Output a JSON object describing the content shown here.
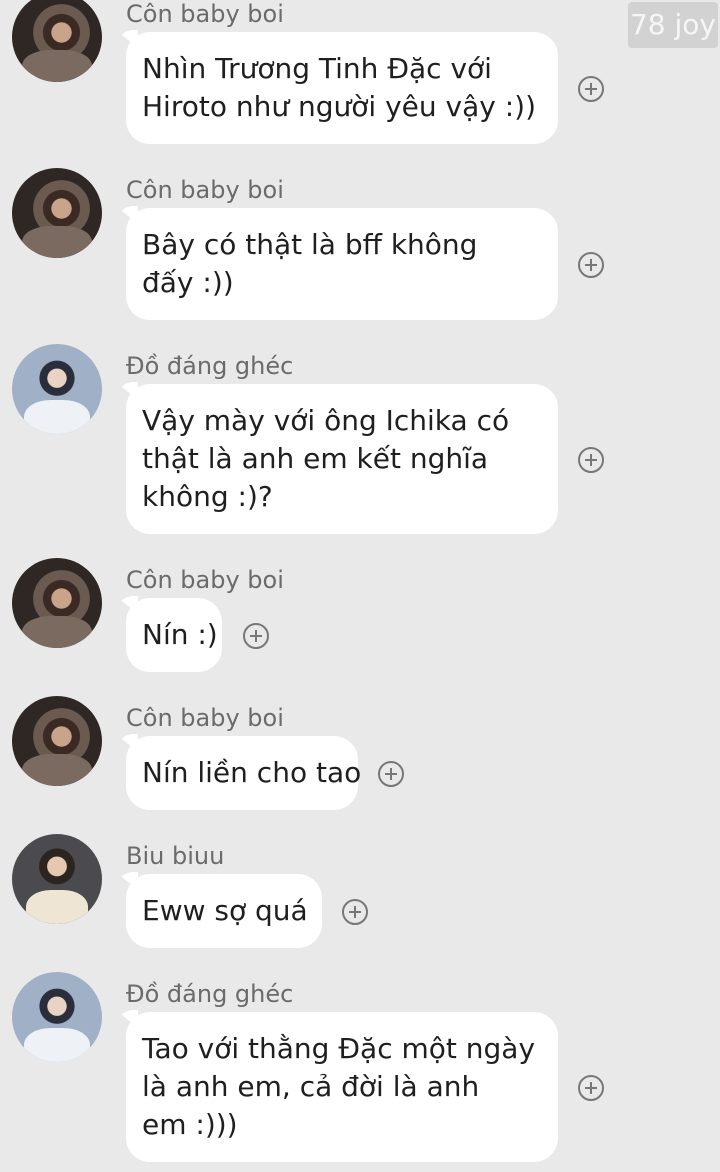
{
  "watermark": "78 joy",
  "messages": [
    {
      "sender": "Côn baby boi",
      "lines": [
        "Nhìn Trương Tinh Đặc với",
        "Hiroto như người yêu vậy :))"
      ]
    },
    {
      "sender": "Côn baby boi",
      "lines": [
        "Bây có thật là bff không",
        "đấy :))"
      ]
    },
    {
      "sender": "Đồ đáng ghéc",
      "lines": [
        "Vậy mày với ông Ichika có",
        "thật là anh em kết nghĩa",
        "không :)?"
      ]
    },
    {
      "sender": "Côn baby boi",
      "lines": [
        "Nín :)"
      ]
    },
    {
      "sender": "Côn baby boi",
      "lines": [
        "Nín liền cho tao"
      ]
    },
    {
      "sender": "Biu biuu",
      "lines": [
        "Eww sợ quá"
      ]
    },
    {
      "sender": "Đồ đáng ghéc",
      "lines": [
        "Tao với thằng Đặc một ngày",
        "là anh em, cả đời là anh",
        "em :)))"
      ]
    }
  ]
}
